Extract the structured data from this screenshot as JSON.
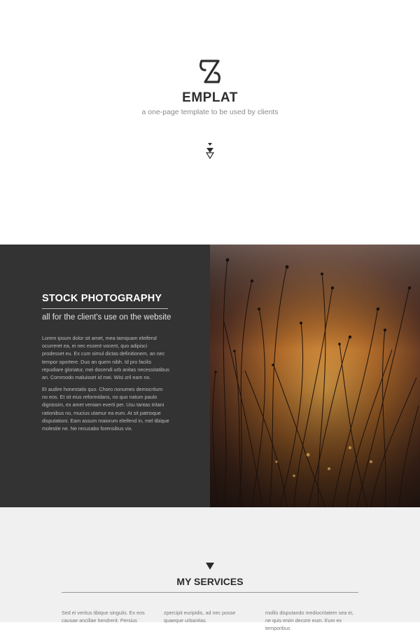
{
  "hero": {
    "brand": "EMPLAT",
    "tagline": "a one-page template to be used by clients",
    "logo_icon": "s-logo-icon",
    "scroll_icon": "double-triangle-down-icon"
  },
  "feature": {
    "title": "STOCK PHOTOGRAPHY",
    "subtitle": "all for the client's use on the website",
    "paragraphs": [
      "Lorem ipsum dolor sit amet, mea tamquam eleifend ocurreret ea, ei nec essent vocent, quo adipisci prodesset eu. Ex cum simul dictas definitionem, an nec tempor oportere. Duo an quem nibh. Id pro facilis repudiare gloriatur, mei docendi urb anitas necessitatibus an. Commodo maluisset id mei. Wisi zril eam no.",
      "Et audire honestatis quo. Choro nonumes democritum no eos. Et sit eius reformidans, no quo natum paulo dignissim, ex amet veniam everti per. Usu tantas tritani rationibus no, mucius utamur ea eum. At sit patrioque disputationi. Eam assum maiorum eleifend in, mel tibique molestie ne. Ne recusabo forensibus vix."
    ],
    "image_icon": "grass-sunset-photo"
  },
  "services": {
    "title": "MY SERVICES",
    "arrow_icon": "triangle-down-icon",
    "columns": [
      "Sed ei veritus tibique singulis. Ex eos causae ancillae hendrerit. Persius",
      "zpercipit euripidis, ad nec posse quaeque urbanitas.",
      "mollis disputando mediocritatem sea ei, ne quis enim decore eum. Eum ex temporibus"
    ]
  },
  "colors": {
    "dark_panel": "#333333",
    "services_bg": "#f0f0f0",
    "text_dark": "#2e2e2e"
  }
}
